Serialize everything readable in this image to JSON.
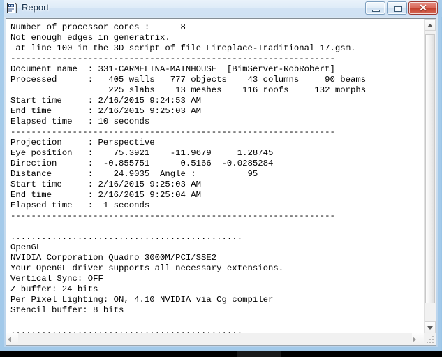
{
  "window": {
    "title": "Report",
    "icon": "report-document-icon",
    "controls": {
      "minimize_label": "–",
      "maximize_label": "□",
      "close_label": "✕"
    }
  },
  "scrollbars": {
    "vertical": {
      "up_arrow": "scroll-up-arrow",
      "down_arrow": "scroll-down-arrow",
      "thumb": "vertical-scroll-thumb"
    },
    "horizontal": {
      "left_arrow": "scroll-left-arrow",
      "right_arrow": "scroll-right-arrow"
    },
    "resize_grip": "resize-grip"
  },
  "report": {
    "lines": [
      "Number of processor cores :      8",
      "Not enough edges in generatrix.",
      " at line 100 in the 3D script of file Fireplace-Traditional 17.gsm.",
      "---------------------------------------------------------------",
      "Document name  : 331-CARMELINA-MAINHOUSE  [BimServer-RobRobert]",
      "Processed      :   405 walls   777 objects    43 columns     90 beams",
      "                   225 slabs    13 meshes    116 roofs     132 morphs",
      "Start time     : 2/16/2015 9:24:53 AM",
      "End time       : 2/16/2015 9:25:03 AM",
      "Elapsed time   : 10 seconds",
      "---------------------------------------------------------------",
      "Projection     : Perspective",
      "Eye position   :    75.3921    -11.9679     1.28745",
      "Direction      :  -0.855751      0.5166  -0.0285284",
      "Distance       :    24.9035  Angle :          95",
      "Start time     : 2/16/2015 9:25:03 AM",
      "End time       : 2/16/2015 9:25:04 AM",
      "Elapsed time   :  1 seconds",
      "---------------------------------------------------------------",
      "",
      ".............................................",
      "OpenGL",
      "NVIDIA Corporation Quadro 3000M/PCI/SSE2",
      "Your OpenGL driver supports all necessary extensions.",
      "Vertical Sync: OFF",
      "Z buffer: 24 bits",
      "Per Pixel Lighting: ON, 4.10 NVIDIA via Cg compiler",
      "Stencil buffer: 8 bits",
      "",
      "............................................."
    ]
  },
  "colors": {
    "frame": "#b9d3ec",
    "titlebar": "#dfecf8",
    "close_button": "#c33f2c",
    "client_background": "#ffffff",
    "text": "#000000"
  }
}
